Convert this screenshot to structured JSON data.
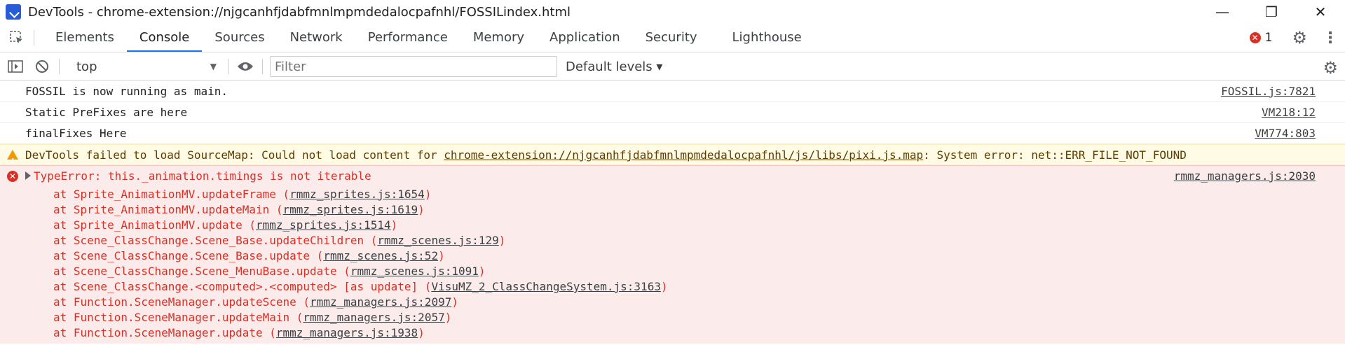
{
  "window": {
    "title": "DevTools - chrome-extension://njgcanhfjdabfmnlmpmdedalocpafnhl/FOSSILindex.html",
    "controls": [
      "minimize",
      "restore",
      "close"
    ]
  },
  "tabs": [
    {
      "label": "Elements",
      "active": false
    },
    {
      "label": "Console",
      "active": true
    },
    {
      "label": "Sources",
      "active": false
    },
    {
      "label": "Network",
      "active": false
    },
    {
      "label": "Performance",
      "active": false
    },
    {
      "label": "Memory",
      "active": false
    },
    {
      "label": "Application",
      "active": false
    },
    {
      "label": "Security",
      "active": false
    },
    {
      "label": "Lighthouse",
      "active": false
    }
  ],
  "error_count": "1",
  "toolbar": {
    "context": "top",
    "filter_placeholder": "Filter",
    "levels": "Default levels ▾"
  },
  "logs": [
    {
      "text": "FOSSIL is now running as main.",
      "source": "FOSSIL.js:7821"
    },
    {
      "text": "Static PreFixes are here",
      "source": "VM218:12"
    },
    {
      "text": "finalFixes Here",
      "source": "VM774:803"
    }
  ],
  "warning": {
    "prefix": "DevTools failed to load SourceMap: Could not load content for ",
    "link": "chrome-extension://njgcanhfjdabfmnlmpmdedalocpafnhl/js/libs/pixi.js.map",
    "suffix": ": System error: net::ERR_FILE_NOT_FOUND"
  },
  "error": {
    "message": "TypeError: this._animation.timings is not iterable",
    "source": "rmmz_managers.js:2030",
    "stack": [
      {
        "at": "at Sprite_AnimationMV.updateFrame (",
        "file": "rmmz_sprites.js:1654",
        "end": ")"
      },
      {
        "at": "at Sprite_AnimationMV.updateMain (",
        "file": "rmmz_sprites.js:1619",
        "end": ")"
      },
      {
        "at": "at Sprite_AnimationMV.update (",
        "file": "rmmz_sprites.js:1514",
        "end": ")"
      },
      {
        "at": "at Scene_ClassChange.Scene_Base.updateChildren (",
        "file": "rmmz_scenes.js:129",
        "end": ")"
      },
      {
        "at": "at Scene_ClassChange.Scene_Base.update (",
        "file": "rmmz_scenes.js:52",
        "end": ")"
      },
      {
        "at": "at Scene_ClassChange.Scene_MenuBase.update (",
        "file": "rmmz_scenes.js:1091",
        "end": ")"
      },
      {
        "at": "at Scene_ClassChange.<computed>.<computed> [as update] (",
        "file": "VisuMZ_2_ClassChangeSystem.js:3163",
        "end": ")"
      },
      {
        "at": "at Function.SceneManager.updateScene (",
        "file": "rmmz_managers.js:2097",
        "end": ")"
      },
      {
        "at": "at Function.SceneManager.updateMain (",
        "file": "rmmz_managers.js:2057",
        "end": ")"
      },
      {
        "at": "at Function.SceneManager.update (",
        "file": "rmmz_managers.js:1938",
        "end": ")"
      }
    ]
  }
}
